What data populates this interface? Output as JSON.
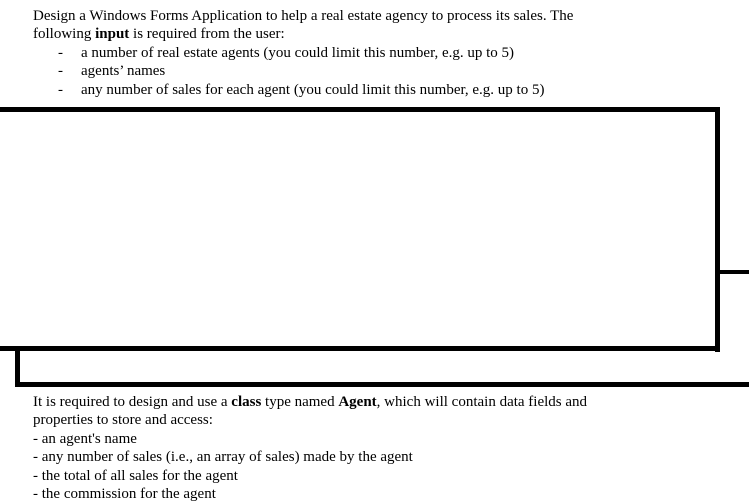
{
  "top_section": {
    "line1": "Design a Windows Forms Application to help a real estate agency to process its sales. The",
    "line2_pre": "following ",
    "line2_bold": "input",
    "line2_post": " is required from the user:",
    "bullet_marker": "-",
    "bullets": [
      "a number of real estate agents (you could limit this number, e.g. up to 5)",
      "agents’ names",
      "any number of sales for each agent (you could limit this number, e.g. up to 5)"
    ]
  },
  "bottom_section": {
    "line1_a": "It is required to design and use a ",
    "line1_bold1": "class",
    "line1_b": " type named ",
    "line1_bold2": "Agent",
    "line1_c": ", which will contain data fields and",
    "line2": "properties to store and access:",
    "items": [
      "- an agent's name",
      "- any number of sales (i.e., an array of sales) made by the agent",
      "- the total of all sales for the agent",
      "- the commission for the agent"
    ]
  }
}
